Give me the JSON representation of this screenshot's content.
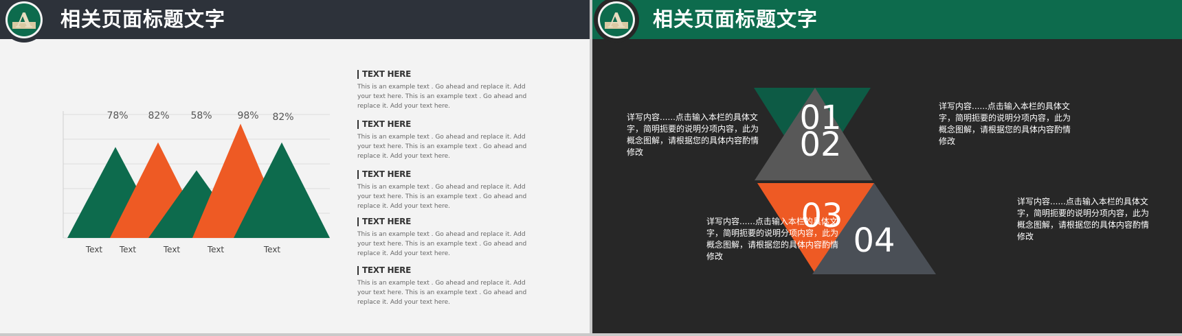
{
  "left_slide": {
    "title": "相关页面标题文字",
    "logo_letter": "A",
    "chart_data": {
      "type": "area",
      "categories": [
        "Text",
        "Text",
        "Text",
        "Text",
        "Text"
      ],
      "values": [
        78,
        82,
        58,
        98,
        82
      ],
      "value_labels": [
        "78%",
        "82%",
        "58%",
        "98%",
        "82%"
      ],
      "colors": [
        "#0d6b4d",
        "#ee5a24",
        "#0d6b4d",
        "#ee5a24",
        "#0d6b4d"
      ],
      "grid": true,
      "title": "",
      "xlabel": "",
      "ylabel": ""
    },
    "legend": [
      {
        "title": "TEXT HERE",
        "body": "This is an example text . Go ahead and replace it. Add your text here. This is an example text . Go ahead and replace it. Add your text here."
      },
      {
        "title": "TEXT HERE",
        "body": "This is an example text . Go ahead and replace it. Add your text here. This is an example text . Go ahead and replace it. Add your text here."
      },
      {
        "title": "TEXT HERE",
        "body": "This is an example text . Go ahead and replace it. Add your text here. This is an example text . Go ahead and replace it. Add your text here."
      },
      {
        "title": "TEXT HERE",
        "body": "This is an example text . Go ahead and replace it. Add your text here. This is an example text . Go ahead and replace it. Add your text here."
      },
      {
        "title": "TEXT HERE",
        "body": "This is an example text . Go ahead and replace it. Add your text here. This is an example text . Go ahead and replace it. Add your text here."
      }
    ]
  },
  "right_slide": {
    "title": "相关页面标题文字",
    "logo_letter": "A",
    "triangles": [
      {
        "number": "01",
        "color": "#0d5b45"
      },
      {
        "number": "02",
        "color": "#585858"
      },
      {
        "number": "03",
        "color": "#ee5a24"
      },
      {
        "number": "04",
        "color": "#4a4f56"
      }
    ],
    "descriptions": [
      "详写内容......点击输入本栏的具体文字，简明扼要的说明分项内容，此为概念图解，请根据您的具体内容酌情修改",
      "详写内容......点击输入本栏的具体文字，简明扼要的说明分项内容，此为概念图解，请根据您的具体内容酌情修改",
      "详写内容......点击输入本栏的具体文字，简明扼要的说明分项内容，此为概念图解，请根据您的具体内容酌情修改",
      "详写内容......点击输入本栏的具体文字，简明扼要的说明分项内容，此为概念图解，请根据您的具体内容酌情修改"
    ]
  }
}
